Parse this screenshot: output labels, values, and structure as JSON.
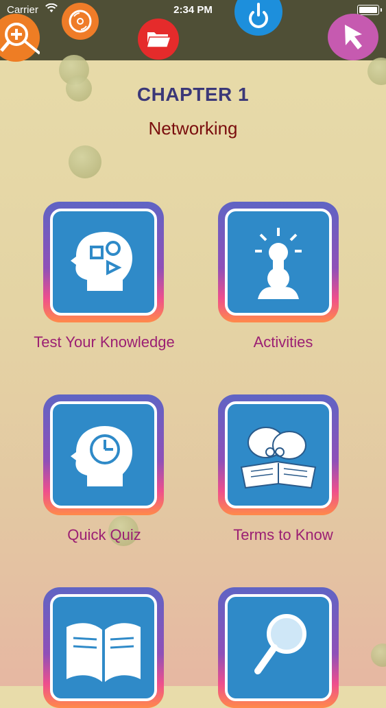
{
  "status_bar": {
    "carrier": "Carrier",
    "time": "2:34 PM"
  },
  "toolbar": {
    "icons": [
      "zoom-in-icon",
      "disc-icon",
      "folder-icon",
      "power-icon",
      "pointer-icon"
    ]
  },
  "header": {
    "chapter": "CHAPTER 1",
    "subject": "Networking"
  },
  "menu": {
    "items": [
      {
        "label": "Test Your Knowledge",
        "icon": "head-shapes-icon"
      },
      {
        "label": "Activities",
        "icon": "lightbulb-person-icon"
      },
      {
        "label": "Quick Quiz",
        "icon": "head-clock-icon"
      },
      {
        "label": "Terms to Know",
        "icon": "reading-book-icon"
      },
      {
        "label": "",
        "icon": "open-book-icon"
      },
      {
        "label": "",
        "icon": "magnifier-icon"
      }
    ]
  },
  "colors": {
    "title": "#3b3878",
    "subject": "#7a0e0e",
    "label": "#9b1f73",
    "tile_blue": "#2f8ac8"
  }
}
